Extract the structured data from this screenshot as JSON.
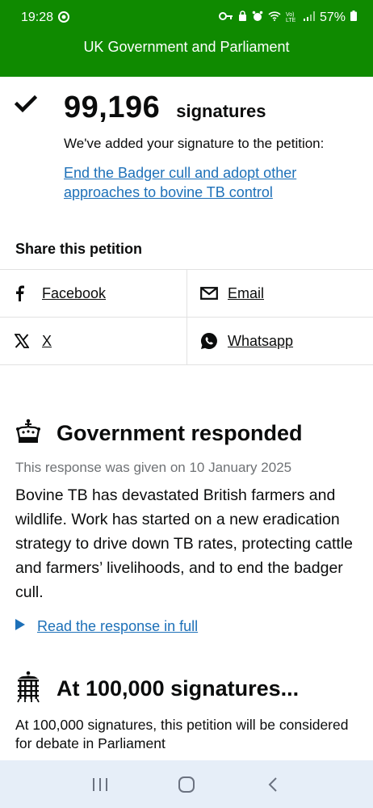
{
  "status_bar": {
    "time": "19:28",
    "battery": "57%",
    "signal_text": "Vo) LTE"
  },
  "header": {
    "title": "UK Government and Parliament"
  },
  "signature": {
    "count": "99,196",
    "count_label": "signatures",
    "added_message": "We've added your signature to the petition:",
    "petition_link": "End the Badger cull and adopt other approaches to bovine TB control"
  },
  "share": {
    "title": "Share this petition",
    "items": [
      {
        "label": "Facebook",
        "icon": "facebook-icon"
      },
      {
        "label": "Email",
        "icon": "email-icon"
      },
      {
        "label": "X",
        "icon": "x-icon"
      },
      {
        "label": "Whatsapp",
        "icon": "whatsapp-icon"
      }
    ]
  },
  "government_response": {
    "title": "Government responded",
    "date_text": "This response was given on 10 January 2025",
    "body": "Bovine TB has devastated British farmers and wildlife. Work has started on a new eradication strategy to drive down TB rates, protecting cattle and farmers’ livelihoods, and to end the badger cull.",
    "read_link": "Read the response in full"
  },
  "debate_threshold": {
    "title": "At 100,000 signatures...",
    "body": "At 100,000 signatures, this petition will be considered for debate in Parliament"
  },
  "colors": {
    "header_green": "#0f8a00",
    "link_blue": "#1d70b8",
    "text": "#0b0c0c",
    "muted": "#6f7275",
    "navbar": "#e6eef8"
  }
}
